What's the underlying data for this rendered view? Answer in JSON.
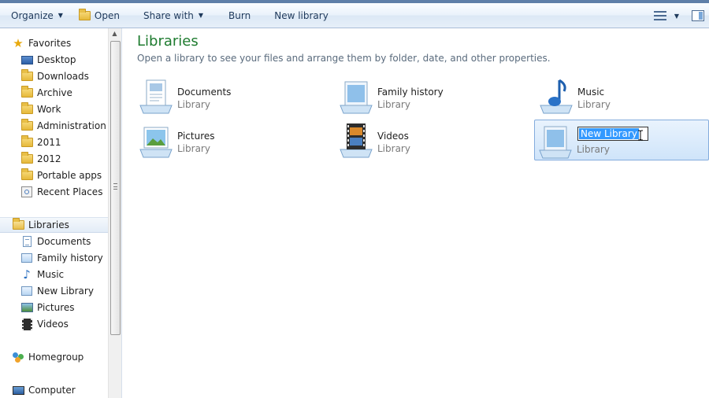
{
  "toolbar": {
    "organize_label": "Organize",
    "open_label": "Open",
    "share_with_label": "Share with",
    "burn_label": "Burn",
    "new_library_label": "New library"
  },
  "nav": {
    "favorites_header": "Favorites",
    "favorites": [
      {
        "label": "Desktop",
        "icon": "desktop-icon"
      },
      {
        "label": "Downloads",
        "icon": "folder-icon"
      },
      {
        "label": "Archive",
        "icon": "folder-icon"
      },
      {
        "label": "Work",
        "icon": "folder-icon"
      },
      {
        "label": "Administration",
        "icon": "folder-icon"
      },
      {
        "label": "2011",
        "icon": "folder-icon"
      },
      {
        "label": "2012",
        "icon": "folder-icon"
      },
      {
        "label": "Portable apps",
        "icon": "folder-icon"
      },
      {
        "label": "Recent Places",
        "icon": "recent-places-icon"
      }
    ],
    "libraries_header": "Libraries",
    "libraries": [
      {
        "label": "Documents",
        "icon": "documents-icon"
      },
      {
        "label": "Family history",
        "icon": "library-icon"
      },
      {
        "label": "Music",
        "icon": "music-note-icon"
      },
      {
        "label": "New Library",
        "icon": "library-icon"
      },
      {
        "label": "Pictures",
        "icon": "pictures-icon"
      },
      {
        "label": "Videos",
        "icon": "film-icon"
      }
    ],
    "homegroup_label": "Homegroup",
    "computer_label": "Computer"
  },
  "main": {
    "title": "Libraries",
    "subtitle": "Open a library to see your files and arrange them by folder, date, and other properties.",
    "tiles": [
      {
        "name": "Documents",
        "kind": "Library",
        "icon": "documents-library-icon"
      },
      {
        "name": "Family history",
        "kind": "Library",
        "icon": "library-icon"
      },
      {
        "name": "Music",
        "kind": "Library",
        "icon": "music-library-icon"
      },
      {
        "name": "Pictures",
        "kind": "Library",
        "icon": "pictures-library-icon"
      },
      {
        "name": "Videos",
        "kind": "Library",
        "icon": "videos-library-icon"
      },
      {
        "name": "New Library",
        "kind": "Library",
        "icon": "library-icon",
        "renaming": true
      }
    ]
  },
  "colors": {
    "title_green": "#1e7b2f",
    "selection_blue": "#3399ff",
    "toolbar_text": "#1e395b"
  }
}
